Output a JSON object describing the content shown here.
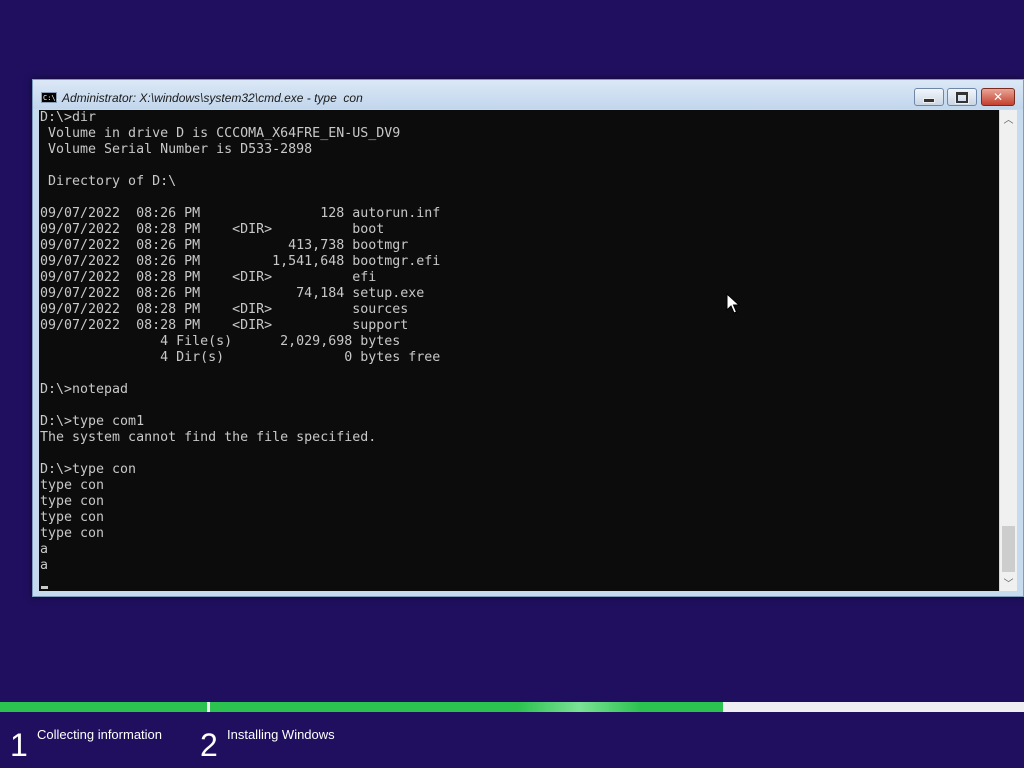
{
  "window": {
    "title": "Administrator: X:\\windows\\system32\\cmd.exe - type  con",
    "icon_text": "C:\\."
  },
  "console": {
    "lines": [
      "D:\\>dir",
      " Volume in drive D is CCCOMA_X64FRE_EN-US_DV9",
      " Volume Serial Number is D533-2898",
      "",
      " Directory of D:\\",
      "",
      "09/07/2022  08:26 PM               128 autorun.inf",
      "09/07/2022  08:28 PM    <DIR>          boot",
      "09/07/2022  08:26 PM           413,738 bootmgr",
      "09/07/2022  08:26 PM         1,541,648 bootmgr.efi",
      "09/07/2022  08:28 PM    <DIR>          efi",
      "09/07/2022  08:26 PM            74,184 setup.exe",
      "09/07/2022  08:28 PM    <DIR>          sources",
      "09/07/2022  08:28 PM    <DIR>          support",
      "               4 File(s)      2,029,698 bytes",
      "               4 Dir(s)               0 bytes free",
      "",
      "D:\\>notepad",
      "",
      "D:\\>type com1",
      "The system cannot find the file specified.",
      "",
      "D:\\>type con",
      "type con",
      "type con",
      "type con",
      "type con",
      "a",
      "a"
    ]
  },
  "setup_progress": {
    "steps": [
      {
        "number": "1",
        "label": "Collecting information",
        "status": "complete"
      },
      {
        "number": "2",
        "label": "Installing Windows",
        "status": "in-progress"
      }
    ],
    "overall_progress_fraction": 0.71,
    "color": "#2cc24f"
  },
  "colors": {
    "desktop": "#1f0f5e",
    "console_bg": "#0c0c0c",
    "console_fg": "#c8c8c8"
  }
}
